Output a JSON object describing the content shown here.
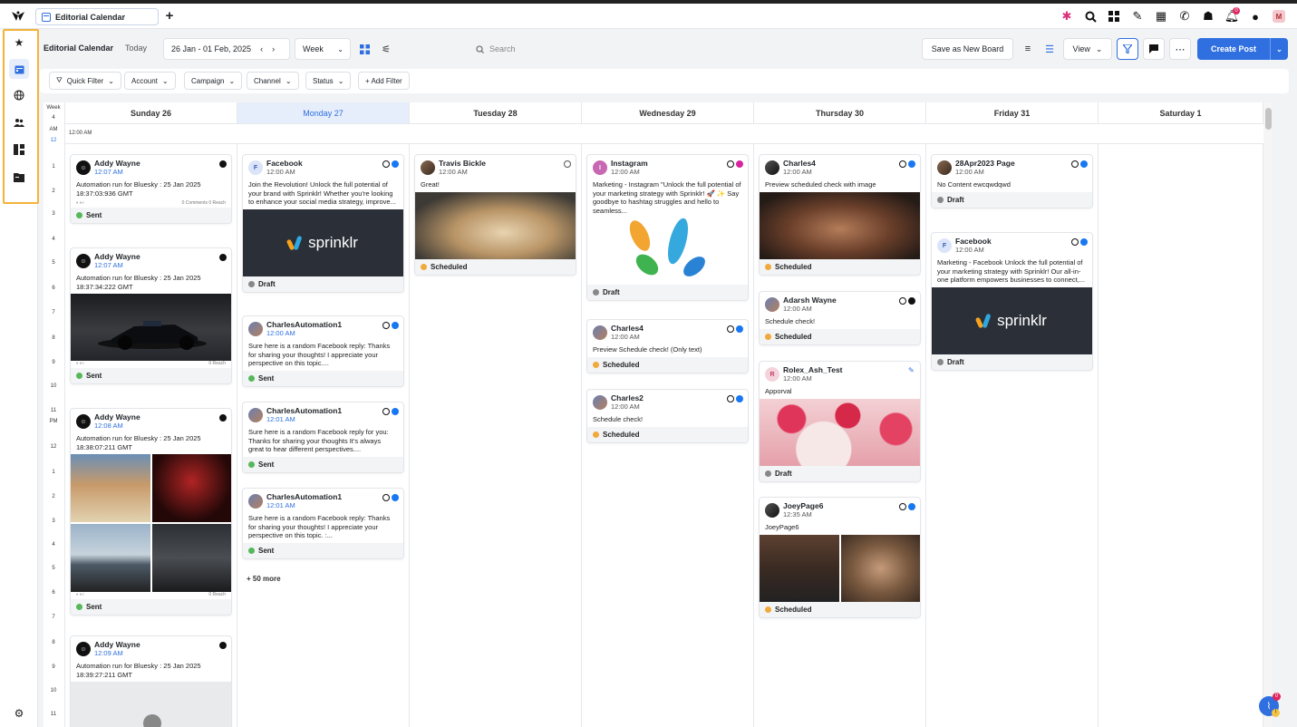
{
  "tab": {
    "title": "Editorial Calendar"
  },
  "topbar": {
    "notification_count": "0",
    "avatar_initial": "M"
  },
  "toolbar": {
    "title": "Editorial Calendar",
    "today": "Today",
    "date_range": "26 Jan - 01 Feb, 2025",
    "view_mode": "Week",
    "search_placeholder": "Search",
    "save_board": "Save as New Board",
    "view": "View",
    "create_post": "Create Post"
  },
  "filters": [
    "Quick Filter",
    "Account",
    "Campaign",
    "Channel",
    "Status",
    "+ Add Filter"
  ],
  "calendar": {
    "week_label": "Week",
    "week_number": "4",
    "all_day_time": "12:00 AM",
    "days": [
      "Sunday 26",
      "Monday 27",
      "Tuesday 28",
      "Wednesday 29",
      "Thursday 30",
      "Friday 31",
      "Saturday 1"
    ],
    "current_day_index": 1,
    "hours": [
      "AM",
      "12",
      "1",
      "2",
      "3",
      "4",
      "5",
      "6",
      "7",
      "8",
      "9",
      "10",
      "11",
      "PM",
      "12",
      "1",
      "2",
      "3",
      "4",
      "5",
      "6",
      "7",
      "8",
      "9",
      "10",
      "11"
    ]
  },
  "columns": [
    {
      "cards": [
        {
          "name": "Addy Wayne",
          "time": "12:07 AM",
          "body": "Automation run for Bluesky : 25 Jan 2025 18:37:03:936 GMT",
          "meta": "0 Comments 0 Reach",
          "status": "Sent",
          "avatar": "bs"
        },
        {
          "name": "Addy Wayne",
          "time": "12:07 AM",
          "body": "Automation run for Bluesky : 25 Jan 2025 18:37:34:222 GMT",
          "meta": "0 Reach",
          "status": "Sent",
          "avatar": "bs"
        },
        {
          "name": "Addy Wayne",
          "time": "12:08 AM",
          "body": "Automation run for Bluesky : 25 Jan 2025 18:38:07:211 GMT",
          "meta": "0 Reach",
          "status": "Sent",
          "avatar": "bs"
        },
        {
          "name": "Addy Wayne",
          "time": "12:09 AM",
          "body": "Automation run for Bluesky : 25 Jan 2025 18:39:27:211 GMT",
          "meta": "",
          "status": "",
          "avatar": "bs"
        }
      ]
    },
    {
      "cards": [
        {
          "name": "Facebook",
          "time": "12:00 AM",
          "body": "Join the Revolution! Unlock the full potential of your brand with Sprinklr! Whether you're looking to enhance your social media strategy, improve...",
          "status": "Draft",
          "avatar_letter": "F",
          "image_text": "sprinklr"
        },
        {
          "name": "CharlesAutomation1",
          "time": "12:00 AM",
          "body": "Sure here is a random Facebook reply: Thanks for sharing your thoughts! I appreciate your perspective on this topic....",
          "status": "Sent"
        },
        {
          "name": "CharlesAutomation1",
          "time": "12:01 AM",
          "body": "Sure here is a random Facebook reply for you: Thanks for sharing your thoughts It's always great to hear different perspectives....",
          "status": "Sent"
        },
        {
          "name": "CharlesAutomation1",
          "time": "12:01 AM",
          "body": "Sure here is a random Facebook reply: Thanks for sharing your thoughts! I appreciate your perspective on this topic. :...",
          "status": "Sent"
        }
      ],
      "more": "+ 50 more"
    },
    {
      "cards": [
        {
          "name": "Travis Bickle",
          "time": "12:00 AM",
          "body": "Great!",
          "status": "Scheduled"
        }
      ]
    },
    {
      "cards": [
        {
          "name": "Instagram",
          "time": "12:00 AM",
          "body": "Marketing - Instagram \"Unlock the full potential of your marketing strategy with Sprinklr! 🚀 ✨ Say goodbye to hashtag struggles and hello to seamless...",
          "status": "Draft",
          "avatar_letter": "I"
        },
        {
          "name": "Charles4",
          "time": "12:00 AM",
          "body": "Preview Schedule check! (Only text)",
          "status": "Scheduled"
        },
        {
          "name": "Charles2",
          "time": "12:00 AM",
          "body": "Schedule check!",
          "status": "Scheduled"
        }
      ]
    },
    {
      "cards": [
        {
          "name": "Charles4",
          "time": "12:00 AM",
          "body": "Preview scheduled check with image",
          "status": "Scheduled"
        },
        {
          "name": "Adarsh Wayne",
          "time": "12:00 AM",
          "body": "Schedule check!",
          "status": "Scheduled"
        },
        {
          "name": "Rolex_Ash_Test",
          "time": "12:00 AM",
          "body": "Apporval",
          "status": "Draft",
          "avatar_letter": "R"
        },
        {
          "name": "JoeyPage6",
          "time": "12:35 AM",
          "body": "JoeyPage6",
          "status": "Scheduled"
        }
      ]
    },
    {
      "cards": [
        {
          "name": "28Apr2023 Page",
          "time": "12:00 AM",
          "body": "No Content ewcqwdqwd",
          "status": "Draft"
        },
        {
          "name": "Facebook",
          "time": "12:00 AM",
          "body": "Marketing - Facebook Unlock the full potential of your marketing strategy with Sprinklr! Our all-in-one platform empowers businesses to connect,...",
          "status": "Draft",
          "avatar_letter": "F",
          "image_text": "sprinklr"
        }
      ]
    },
    {
      "cards": []
    }
  ]
}
